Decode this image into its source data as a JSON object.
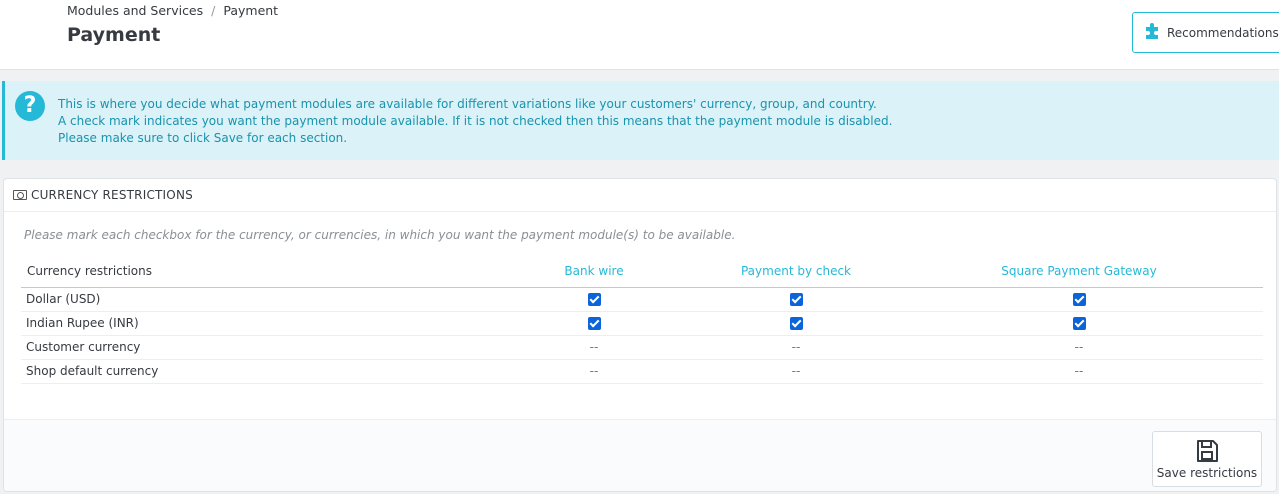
{
  "breadcrumb": {
    "parent": "Modules and Services",
    "separator": "/",
    "current": "Payment"
  },
  "page_title": "Payment",
  "toolbar": {
    "recommendations_label": "Recommendations",
    "recommendations_icon": "puzzle-icon"
  },
  "alert": {
    "icon": "help-icon",
    "lines": [
      "This is where you decide what payment modules are available for different variations like your customers' currency, group, and country.",
      "A check mark indicates you want the payment module available. If it is not checked then this means that the payment module is disabled.",
      "Please make sure to click Save for each section."
    ]
  },
  "panel": {
    "icon": "money-icon",
    "title": "CURRENCY RESTRICTIONS",
    "hint": "Please mark each checkbox for the currency, or currencies, in which you want the payment module(s) to be available.",
    "columns": [
      "Currency restrictions",
      "Bank wire",
      "Payment by check",
      "Square Payment Gateway"
    ],
    "rows": [
      {
        "label": "Dollar (USD)",
        "cells": [
          true,
          true,
          true
        ]
      },
      {
        "label": "Indian Rupee (INR)",
        "cells": [
          true,
          true,
          true
        ]
      },
      {
        "label": "Customer currency",
        "cells": [
          "--",
          "--",
          "--"
        ]
      },
      {
        "label": "Shop default currency",
        "cells": [
          "--",
          "--",
          "--"
        ]
      }
    ],
    "save_label": "Save restrictions",
    "save_icon": "floppy-disk-icon"
  },
  "colors": {
    "accent": "#25b9d7",
    "checkbox": "#0b64d9",
    "alert_bg": "#daf2f8",
    "alert_text": "#1a93ad"
  }
}
